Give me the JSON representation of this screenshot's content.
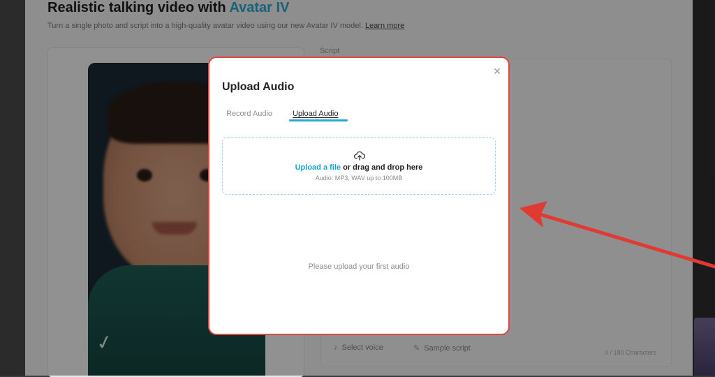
{
  "background": {
    "title_main": "Realistic talking video with ",
    "title_accent": "Avatar IV",
    "subtitle": "Turn a single photo and script into a high-quality avatar video using our new Avatar IV model.",
    "subtitle_link": "Learn more",
    "panel_label": "Script",
    "select_voice_label": "Select voice",
    "sample_script_label": "Sample script",
    "char_counter": "0 / 180 Characters"
  },
  "modal": {
    "title": "Upload Audio",
    "tabs": [
      {
        "label": "Record Audio",
        "active": false
      },
      {
        "label": "Upload Audio",
        "active": true
      }
    ],
    "dropzone": {
      "icon": "upload-cloud-icon",
      "link_text": "Upload a file",
      "rest_text": " or drag and drop here",
      "hint": "Audio: MP3, WAV up to 100MB"
    },
    "empty_message": "Please upload your first audio",
    "close_icon": "close-icon"
  },
  "colors": {
    "accent": "#2aa7d6",
    "modal_border": "#e0473e",
    "annotation_arrow": "#e03a33"
  }
}
